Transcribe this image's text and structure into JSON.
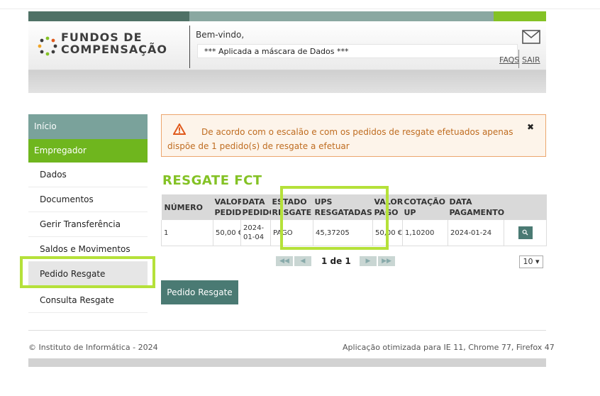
{
  "header": {
    "brand_line1": "FUNDOS DE",
    "brand_line2": "COMPENSAÇÃO",
    "welcome": "Bem-vindo,",
    "mask_notice": "*** Aplicada a máscara de Dados ***",
    "faqs": "FAQS",
    "sair": "SAIR",
    "icons": {
      "mail": "mail-icon",
      "logo": "logo-icon"
    }
  },
  "sidebar": {
    "inicio": "Início",
    "section": "Empregador",
    "items": [
      {
        "label": "Dados"
      },
      {
        "label": "Documentos"
      },
      {
        "label": "Gerir Transferência"
      },
      {
        "label": "Saldos e Movimentos FCT"
      },
      {
        "label": "Pedido Resgate",
        "selected": true
      },
      {
        "label": "Consulta Resgate"
      }
    ]
  },
  "alert": {
    "text": "De acordo com o escalão e com os pedidos de resgate efetuados apenas dispõe de 1 pedido(s) de resgate a efetuar",
    "close": "✖"
  },
  "main": {
    "title": "RESGATE FCT",
    "table": {
      "headers": {
        "numero": "NÚMERO",
        "valor_pedido_1": "VALOR",
        "valor_pedido_2": "PEDIDO",
        "data_pedido_1": "DATA",
        "data_pedido_2": "PEDIDO",
        "estado_1": "ESTADO",
        "estado_2": "RESGATE",
        "ups_1": "UPS",
        "ups_2": "RESGATADAS",
        "valor_pago_1": "VALOR",
        "valor_pago_2": "PAGO",
        "cotacao_1": "COTAÇÃO",
        "cotacao_2": "UP",
        "data_pag_1": "DATA",
        "data_pag_2": "PAGAMENTO"
      },
      "rows": [
        {
          "numero": "1",
          "valor_pedido": "50,00 €",
          "data_pedido_1": "2024-",
          "data_pedido_2": "01-04",
          "estado": "PAGO",
          "ups": "45,37205",
          "valor_pago": "50,00 €",
          "cotacao": "1,10200",
          "data_pagamento": "2024-01-24",
          "action_icon": "search-icon"
        }
      ]
    },
    "pager": {
      "text": "1 de 1",
      "page_size": "10 ▾"
    },
    "button": "Pedido Resgate"
  },
  "footer": {
    "left": "© Instituto de Informática - 2024",
    "right": "Aplicação otimizada para IE 11, Chrome 77, Firefox 47"
  },
  "colors": {
    "brand_green": "#84c225",
    "teal": "#4a7a73",
    "highlight": "#b5e13a",
    "alert_border": "#eca66e"
  }
}
